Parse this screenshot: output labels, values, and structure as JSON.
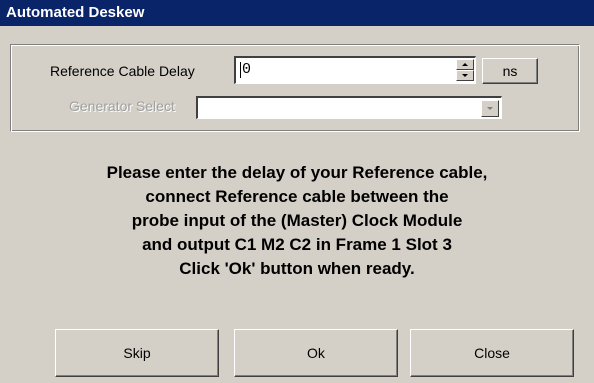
{
  "window": {
    "title": "Automated Deskew"
  },
  "form": {
    "reference_cable_delay": {
      "label": "Reference Cable Delay",
      "value": "0",
      "unit_label": "ns"
    },
    "generator_select": {
      "label": "Generator Select",
      "value": "",
      "enabled": false
    }
  },
  "message": {
    "lines": [
      "Please enter the delay of your Reference cable,",
      "connect Reference cable between the",
      "probe input of the (Master) Clock Module",
      "and output C1 M2 C2 in Frame 1 Slot 3",
      "Click 'Ok' button when ready."
    ]
  },
  "buttons": {
    "skip_label": "Skip",
    "ok_label": "Ok",
    "close_label": "Close"
  },
  "colors": {
    "titlebar": "#0a246a",
    "face": "#d4d0c8",
    "disabled_text": "#a0a0a0"
  }
}
